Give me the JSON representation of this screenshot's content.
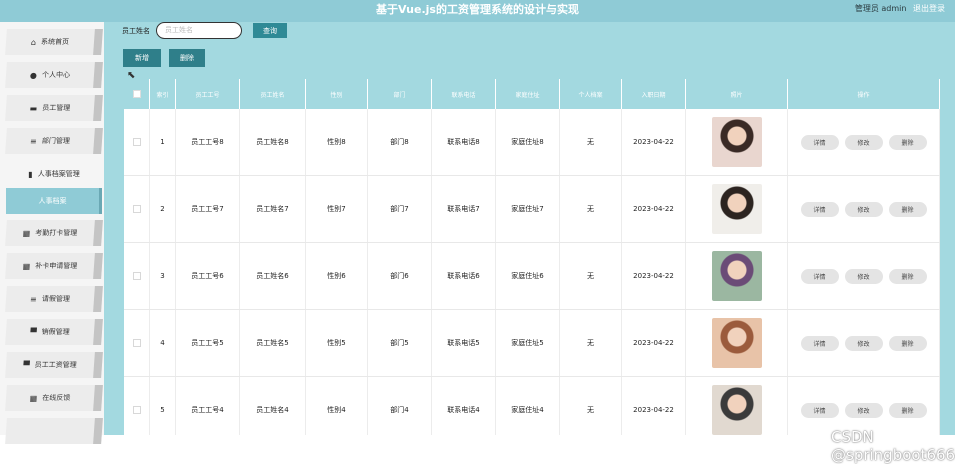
{
  "header": {
    "title": "基于Vue.js的工资管理系统的设计与实现",
    "user": "管理员 admin",
    "logout": "退出登录"
  },
  "sidebar": {
    "items": [
      {
        "label": "系统首页",
        "icon": "home-icon",
        "glyph": "⌂"
      },
      {
        "label": "个人中心",
        "icon": "person-icon",
        "glyph": "●"
      },
      {
        "label": "员工管理",
        "icon": "briefcase-icon",
        "glyph": "▬"
      },
      {
        "label": "部门管理",
        "icon": "list-icon",
        "glyph": "≡"
      },
      {
        "label": "人事档案管理",
        "icon": "file-icon",
        "glyph": "▮"
      },
      {
        "label": "人事档案",
        "icon": "",
        "glyph": ""
      },
      {
        "label": "考勤打卡管理",
        "icon": "grid-icon",
        "glyph": "▦"
      },
      {
        "label": "补卡申请管理",
        "icon": "grid-icon",
        "glyph": "▦"
      },
      {
        "label": "请假管理",
        "icon": "list-icon",
        "glyph": "≡"
      },
      {
        "label": "销假管理",
        "icon": "monitor-icon",
        "glyph": "▀"
      },
      {
        "label": "员工工资管理",
        "icon": "wallet-icon",
        "glyph": "▀"
      },
      {
        "label": "在线反馈",
        "icon": "grid-icon",
        "glyph": "▦"
      }
    ]
  },
  "search": {
    "label": "员工姓名",
    "placeholder": "员工姓名",
    "button": "查询"
  },
  "toolbar": {
    "add": "新增",
    "delete": "删除"
  },
  "table": {
    "headers": [
      "索引",
      "员工工号",
      "员工姓名",
      "性别",
      "部门",
      "联系电话",
      "家庭住址",
      "个人档案",
      "入职日期",
      "照片",
      "操作"
    ],
    "rows": [
      {
        "index": "1",
        "no": "员工工号8",
        "name": "员工姓名8",
        "sex": "性别8",
        "dept": "部门8",
        "tel": "联系电话8",
        "addr": "家庭住址8",
        "file": "无",
        "date": "2023-04-22"
      },
      {
        "index": "2",
        "no": "员工工号7",
        "name": "员工姓名7",
        "sex": "性别7",
        "dept": "部门7",
        "tel": "联系电话7",
        "addr": "家庭住址7",
        "file": "无",
        "date": "2023-04-22"
      },
      {
        "index": "3",
        "no": "员工工号6",
        "name": "员工姓名6",
        "sex": "性别6",
        "dept": "部门6",
        "tel": "联系电话6",
        "addr": "家庭住址6",
        "file": "无",
        "date": "2023-04-22"
      },
      {
        "index": "4",
        "no": "员工工号5",
        "name": "员工姓名5",
        "sex": "性别5",
        "dept": "部门5",
        "tel": "联系电话5",
        "addr": "家庭住址5",
        "file": "无",
        "date": "2023-04-22"
      },
      {
        "index": "5",
        "no": "员工工号4",
        "name": "员工姓名4",
        "sex": "性别4",
        "dept": "部门4",
        "tel": "联系电话4",
        "addr": "家庭住址4",
        "file": "无",
        "date": "2023-04-22"
      }
    ],
    "actions": {
      "detail": "详情",
      "edit": "修改",
      "delete": "删除"
    }
  },
  "watermark": "CSDN @springboot666666",
  "colors": {
    "accent": "#8fcbd6",
    "main_bg": "#a3d9e0",
    "button": "#2f7f8a"
  }
}
